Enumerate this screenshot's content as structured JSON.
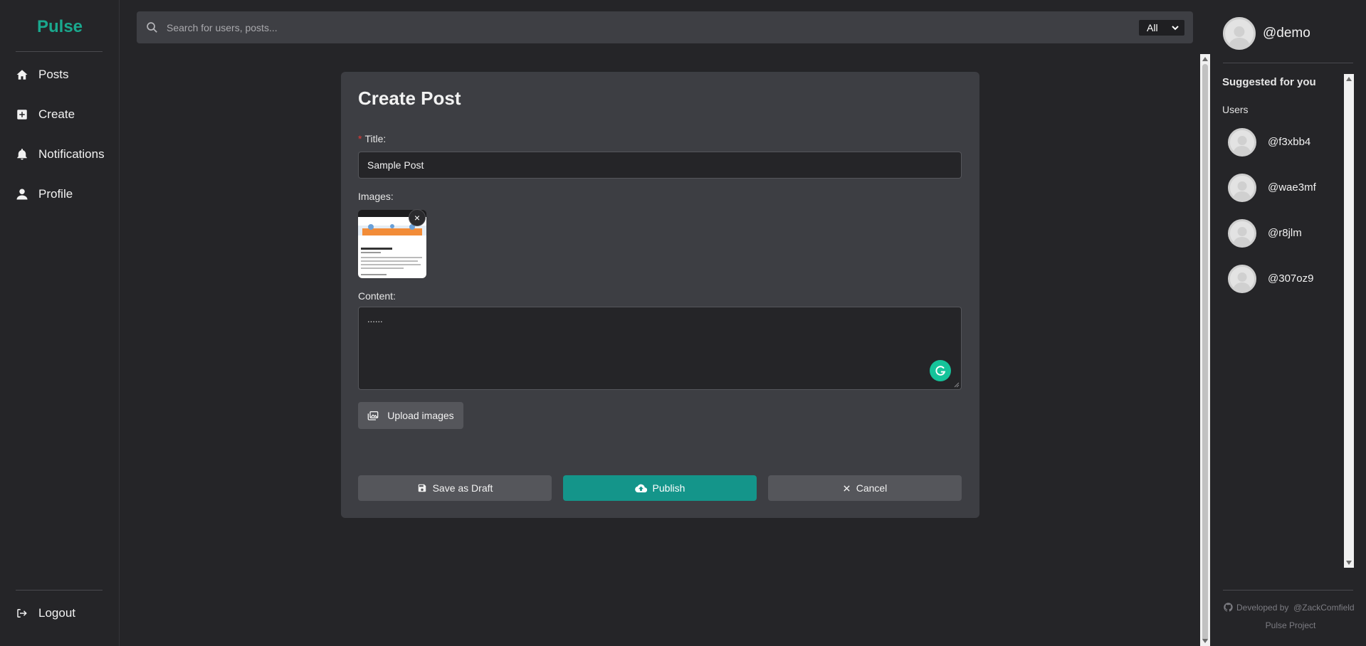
{
  "app": {
    "logo": "Pulse"
  },
  "sidebar": {
    "items": [
      {
        "label": "Posts",
        "icon": "home-icon"
      },
      {
        "label": "Create",
        "icon": "plus-square-icon"
      },
      {
        "label": "Notifications",
        "icon": "bell-icon"
      },
      {
        "label": "Profile",
        "icon": "user-icon"
      }
    ],
    "logout": {
      "label": "Logout",
      "icon": "logout-icon"
    }
  },
  "search": {
    "placeholder": "Search for users, posts...",
    "filter_value": "All"
  },
  "form": {
    "title": "Create Post",
    "title_label": "Title:",
    "title_required_mark": "*",
    "title_value": "Sample Post",
    "images_label": "Images:",
    "remove_image_glyph": "×",
    "content_label": "Content:",
    "content_value": "......",
    "upload_label": "Upload images",
    "save_draft_label": "Save as Draft",
    "publish_label": "Publish",
    "cancel_label": "Cancel"
  },
  "right_panel": {
    "current_user": "@demo",
    "suggested_title": "Suggested for you",
    "users_label": "Users",
    "users": [
      "@f3xbb4",
      "@wae3mf",
      "@r8jlm",
      "@307oz9"
    ],
    "footer_developed": "Developed by",
    "footer_author": "@ZackComfield",
    "footer_project": "Pulse Project"
  },
  "colors": {
    "accent": "#1aa88e",
    "publish": "#14958a",
    "background": "#252528",
    "card": "#3d3e43"
  }
}
